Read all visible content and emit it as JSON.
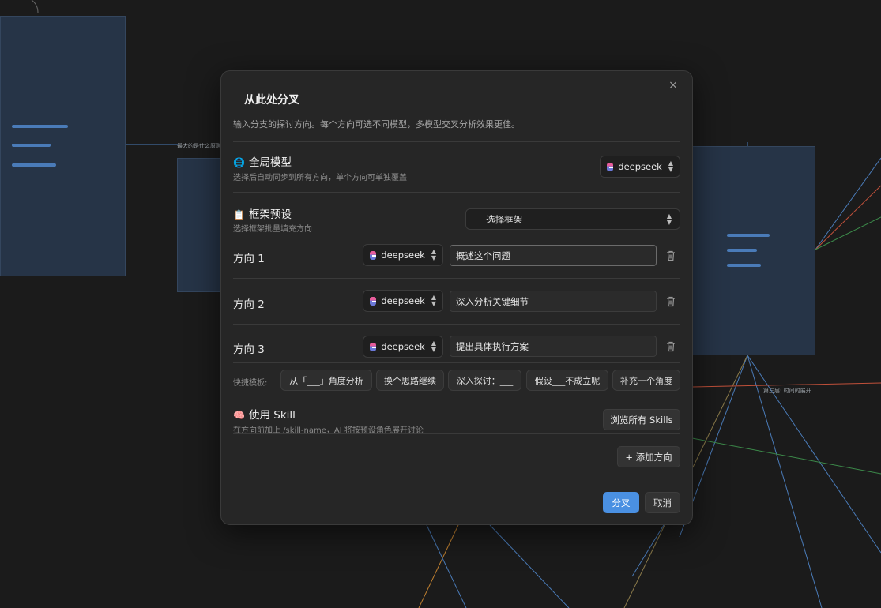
{
  "canvas": {
    "edge_label_1": "最大的是什么原则",
    "edge_label_2": "第三层: 时间的展开"
  },
  "dialog": {
    "title": "从此处分叉",
    "subtitle": "输入分支的探讨方向。每个方向可选不同模型，多模型交叉分析效果更佳。",
    "close_icon": "×",
    "global_model": {
      "icon": "🌐",
      "title": "全局模型",
      "hint": "选择后自动同步到所有方向，单个方向可单独覆盖",
      "model": "deepseek"
    },
    "framework": {
      "icon": "📋",
      "title": "框架预设",
      "hint": "选择框架批量填充方向",
      "selected": "— 选择框架 —"
    },
    "directions": [
      {
        "label": "方向 1",
        "model": "deepseek",
        "value": "概述这个问题"
      },
      {
        "label": "方向 2",
        "model": "deepseek",
        "value": "深入分析关键细节"
      },
      {
        "label": "方向 3",
        "model": "deepseek",
        "value": "提出具体执行方案"
      }
    ],
    "quick_templates": {
      "label": "快捷模板:",
      "items": [
        "从「___」角度分析",
        "换个思路继续",
        "深入探讨：___",
        "假设___不成立呢",
        "补充一个角度"
      ]
    },
    "skill": {
      "icon": "🧠",
      "title": "使用 Skill",
      "hint": "在方向前加上 /skill-name，AI 将按预设角色展开讨论",
      "browse_label": "浏览所有 Skills"
    },
    "add_direction_label": "+ 添加方向",
    "submit_label": "分叉",
    "cancel_label": "取消"
  },
  "colors": {
    "background": "#1b1b1b",
    "dialog": "#262626",
    "node": "#263447",
    "accent": "#4a90e2"
  }
}
